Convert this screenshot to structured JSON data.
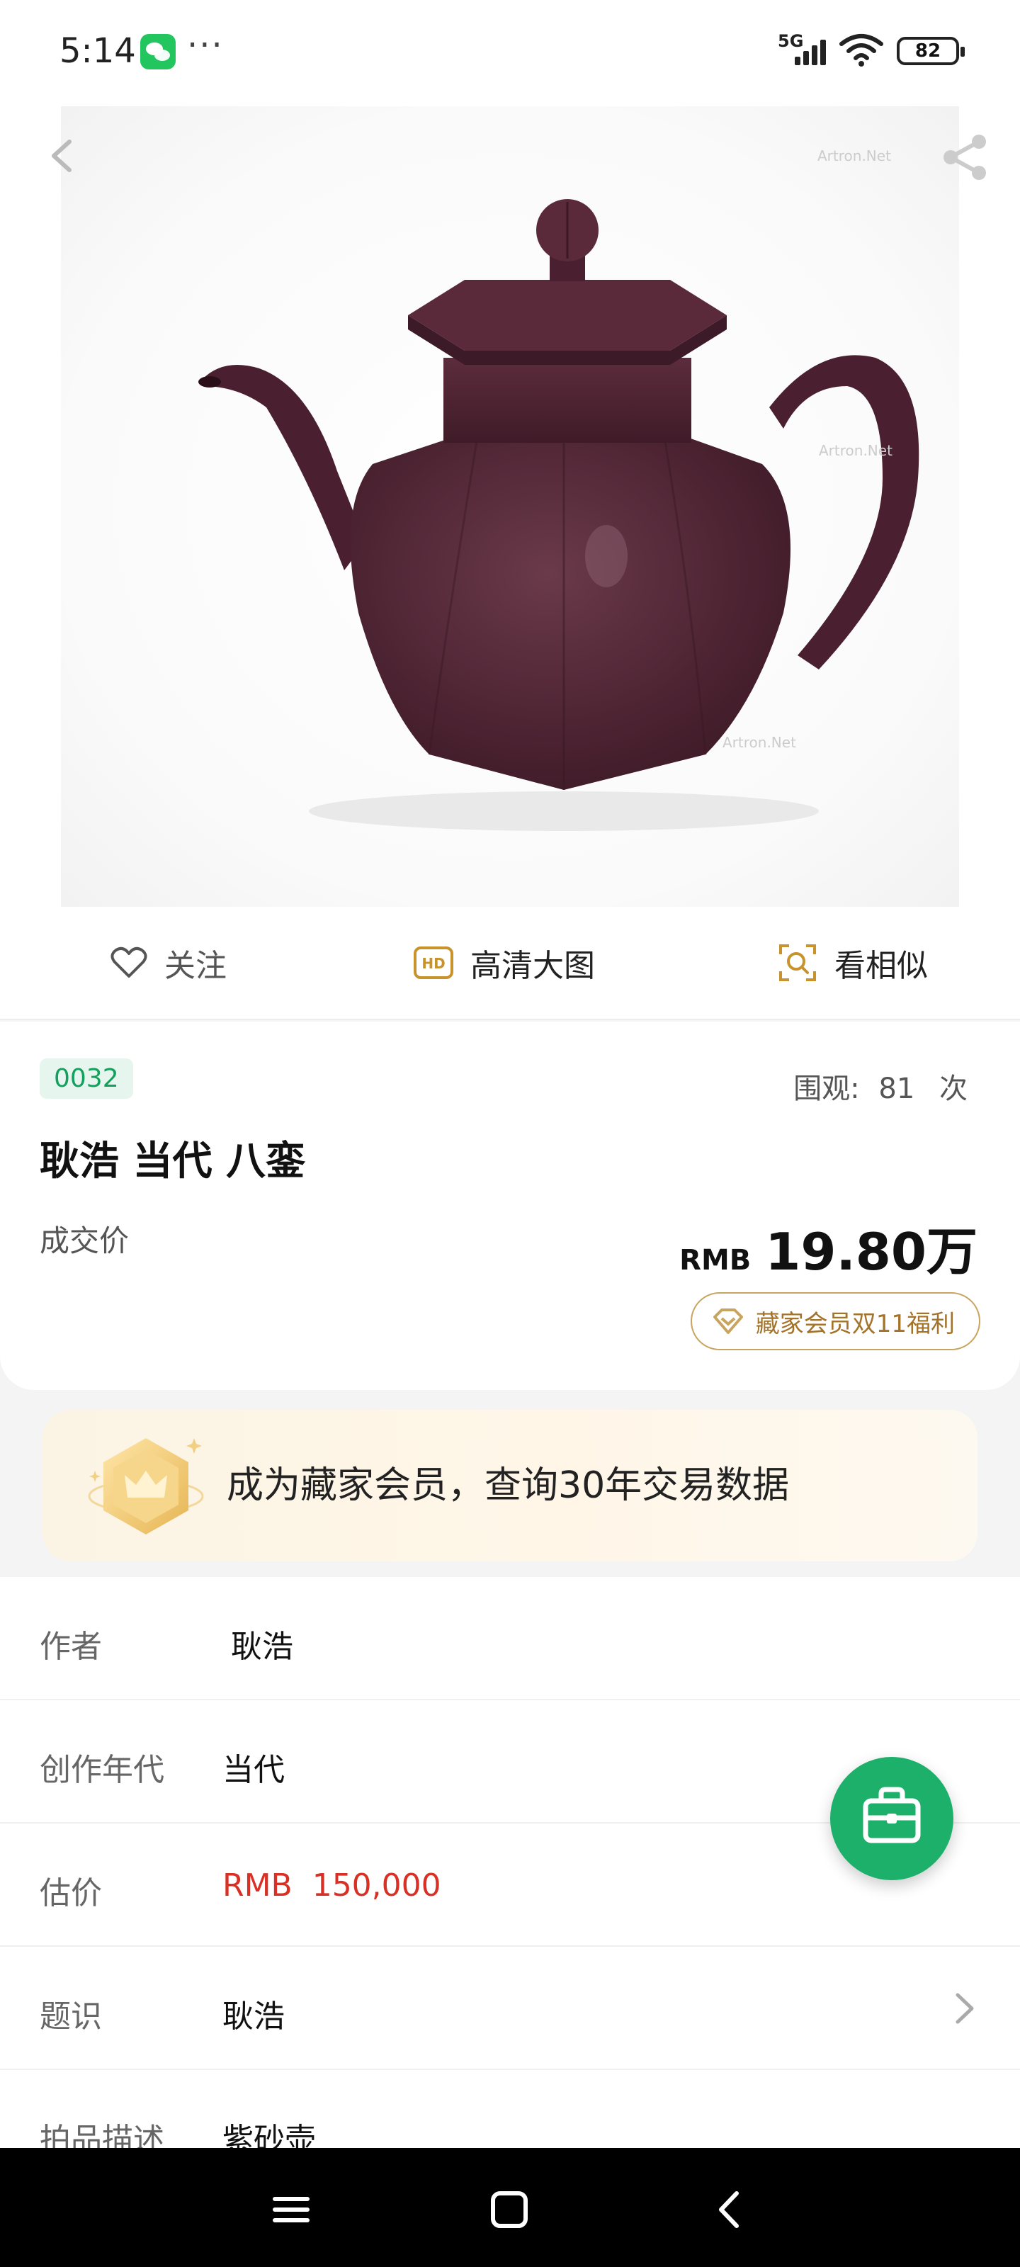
{
  "status_bar": {
    "time": "5:14",
    "more": "···",
    "network": "5G",
    "battery": "82"
  },
  "hero": {
    "watermark": "Artron.Net"
  },
  "actions": {
    "follow": "关注",
    "hd": "高清大图",
    "hd_icon": "HD",
    "similar": "看相似"
  },
  "lot": {
    "number": "0032",
    "views_label": "围观:",
    "views_count": "81",
    "views_unit": "次",
    "title": "耿浩 当代 八銮",
    "deal_label": "成交价",
    "price_currency": "RMB",
    "price_value": "19.80万",
    "vip_chip": "藏家会员双11福利"
  },
  "banner": {
    "text": "成为藏家会员，查询30年交易数据"
  },
  "details": {
    "rows": [
      {
        "label": "作者",
        "value": "耿浩"
      },
      {
        "label": "创作年代",
        "value": "当代"
      },
      {
        "label": "估价",
        "value": "RMB  150,000"
      },
      {
        "label": "题识",
        "value": "耿浩"
      },
      {
        "label": "拍品描述",
        "value": "紫砂壶"
      }
    ]
  },
  "colors": {
    "accent_green": "#1cb06a",
    "price_red": "#d93025",
    "gold": "#c8a55e"
  }
}
